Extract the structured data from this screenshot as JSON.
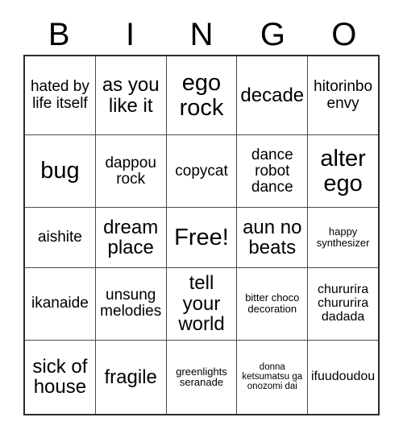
{
  "card": {
    "title": "BINGO",
    "header_letters": [
      "B",
      "I",
      "N",
      "G",
      "O"
    ],
    "free_space_label": "Free!",
    "colors": {
      "background": "#ffffff",
      "text": "#000000",
      "grid_border": "#2b2b2b",
      "cell_border": "#4a4a4a"
    },
    "rows": [
      [
        {
          "text": "hated by life itself",
          "size": "md"
        },
        {
          "text": "as you like it",
          "size": "lg"
        },
        {
          "text": "ego rock",
          "size": "xl"
        },
        {
          "text": "decade",
          "size": "lg"
        },
        {
          "text": "hitorinbo envy",
          "size": "md"
        }
      ],
      [
        {
          "text": "bug",
          "size": "xl"
        },
        {
          "text": "dappou rock",
          "size": "md"
        },
        {
          "text": "copycat",
          "size": "md"
        },
        {
          "text": "dance robot dance",
          "size": "md"
        },
        {
          "text": "alter ego",
          "size": "xl"
        }
      ],
      [
        {
          "text": "aishite",
          "size": "md"
        },
        {
          "text": "dream place",
          "size": "lg"
        },
        {
          "text": "Free!",
          "size": "xl"
        },
        {
          "text": "aun no beats",
          "size": "lg"
        },
        {
          "text": "happy synthesizer",
          "size": "xs"
        }
      ],
      [
        {
          "text": "ikanaide",
          "size": "md"
        },
        {
          "text": "unsung melodies",
          "size": "md"
        },
        {
          "text": "tell your world",
          "size": "lg"
        },
        {
          "text": "bitter choco decoration",
          "size": "xs"
        },
        {
          "text": "chururira chururira dadada",
          "size": "sm"
        }
      ],
      [
        {
          "text": "sick of house",
          "size": "lg"
        },
        {
          "text": "fragile",
          "size": "lg"
        },
        {
          "text": "greenlights seranade",
          "size": "xs"
        },
        {
          "text": "donna ketsumatsu ga onozomi dai",
          "size": "xxs"
        },
        {
          "text": "ifuudoudou",
          "size": "sm"
        }
      ]
    ]
  }
}
